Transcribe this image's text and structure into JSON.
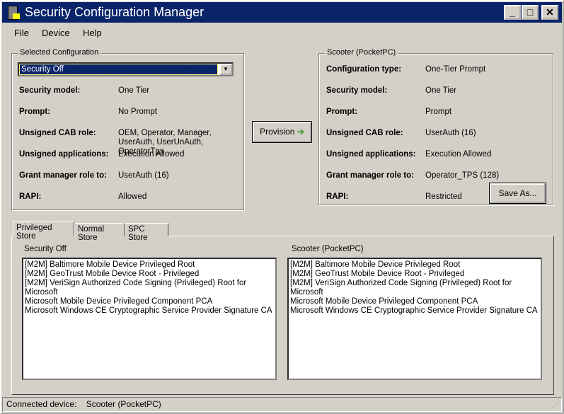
{
  "window": {
    "title": "Security Configuration Manager",
    "minimize": "_",
    "maximize": "□",
    "close": "✕"
  },
  "menu": [
    {
      "label": "File"
    },
    {
      "label": "Device"
    },
    {
      "label": "Help"
    }
  ],
  "selected": {
    "group_label": "Selected Configuration",
    "dropdown_value": "Security Off",
    "rows": [
      {
        "label": "Security model:",
        "value": "One Tier"
      },
      {
        "label": "Prompt:",
        "value": "No Prompt"
      },
      {
        "label": "Unsigned CAB role:",
        "value": "OEM, Operator, Manager, UserAuth, UserUnAuth, OperatorTps"
      },
      {
        "label": "Unsigned applications:",
        "value": "Execution Allowed"
      },
      {
        "label": "Grant manager role to:",
        "value": "UserAuth (16)"
      },
      {
        "label": "RAPI:",
        "value": "Allowed"
      }
    ]
  },
  "provision_label": "Provision",
  "device": {
    "group_label": "Scooter (PocketPC)",
    "rows": [
      {
        "label": "Configuration type:",
        "value": "One-Tier Prompt"
      },
      {
        "label": "Security model:",
        "value": "One Tier"
      },
      {
        "label": "Prompt:",
        "value": "Prompt"
      },
      {
        "label": "Unsigned CAB role:",
        "value": "UserAuth (16)"
      },
      {
        "label": "Unsigned applications:",
        "value": "Execution Allowed"
      },
      {
        "label": "Grant manager role to:",
        "value": "Operator_TPS (128)"
      },
      {
        "label": "RAPI:",
        "value": "Restricted"
      }
    ],
    "save_as_label": "Save As..."
  },
  "tabs": [
    {
      "label": "Privileged Store",
      "active": true
    },
    {
      "label": "Normal Store"
    },
    {
      "label": "SPC Store"
    }
  ],
  "stores": {
    "left_title": "Security Off",
    "right_title": "Scooter (PocketPC)",
    "left_items": [
      "[M2M] Baltimore Mobile Device Privileged Root",
      "[M2M] GeoTrust Mobile Device Root - Privileged",
      "[M2M] VeriSign Authorized Code Signing (Privileged) Root for Microsoft",
      "Microsoft Mobile Device Privileged Component PCA",
      "Microsoft Windows CE Cryptographic Service Provider Signature CA"
    ],
    "right_items": [
      "[M2M] Baltimore Mobile Device Privileged Root",
      "[M2M] GeoTrust Mobile Device Root - Privileged",
      "[M2M] VeriSign Authorized Code Signing (Privileged) Root for Microsoft",
      "Microsoft Mobile Device Privileged Component PCA",
      "Microsoft Windows CE Cryptographic Service Provider Signature CA"
    ]
  },
  "status": {
    "label": "Connected device:",
    "value": "Scooter (PocketPC)"
  },
  "colors": {
    "titlebar": "#0a246a",
    "face": "#d4d0c8"
  }
}
